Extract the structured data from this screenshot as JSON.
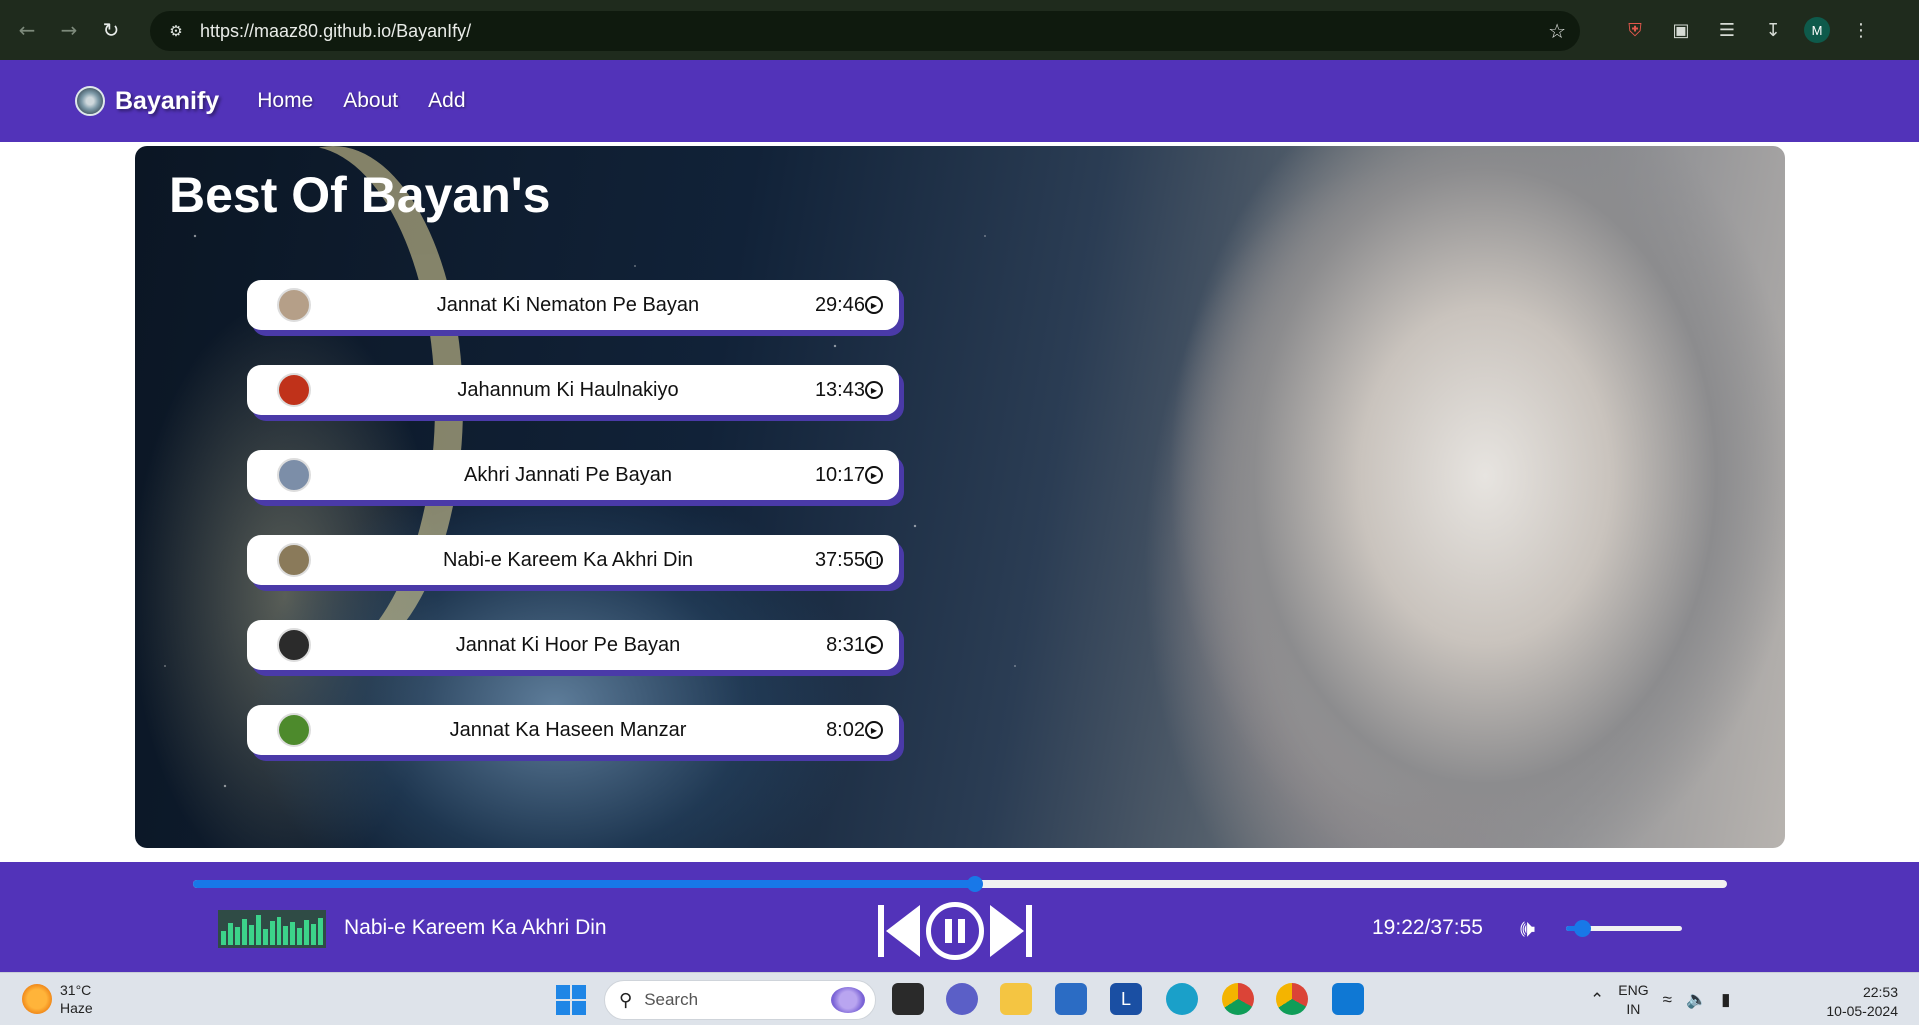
{
  "browser": {
    "url": "https://maaz80.github.io/BayanIfy/",
    "profile_initial": "M",
    "icons": [
      "back-icon",
      "forward-icon",
      "reload-icon",
      "site-info-icon",
      "bookmark-star-icon",
      "shield-extension-icon",
      "extensions-icon",
      "media-queue-icon",
      "download-icon",
      "menu-kebab-icon"
    ]
  },
  "nav": {
    "brand": "Bayanify",
    "links": [
      "Home",
      "About",
      "Add"
    ]
  },
  "banner": {
    "title": "Best Of Bayan's"
  },
  "songs": [
    {
      "title": "Jannat Ki Nematon Pe Bayan",
      "duration": "29:46",
      "state": "play",
      "thumb_color": "#b59f88"
    },
    {
      "title": "Jahannum Ki Haulnakiyo",
      "duration": "13:43",
      "state": "play",
      "thumb_color": "#c0321a"
    },
    {
      "title": "Akhri Jannati Pe Bayan",
      "duration": "10:17",
      "state": "play",
      "thumb_color": "#7c8ea8"
    },
    {
      "title": "Nabi-e Kareem Ka Akhri Din",
      "duration": "37:55",
      "state": "pause",
      "thumb_color": "#8a7a5a"
    },
    {
      "title": "Jannat Ki Hoor Pe Bayan",
      "duration": "8:31",
      "state": "play",
      "thumb_color": "#2b2b2b"
    },
    {
      "title": "Jannat Ka Haseen Manzar",
      "duration": "8:02",
      "state": "play",
      "thumb_color": "#4d8a2c"
    }
  ],
  "player": {
    "now_playing": "Nabi-e Kareem Ka Akhri Din",
    "time": "19:22/37:55",
    "progress_fraction": 0.51,
    "volume_fraction": 0.14,
    "accent": "#1878e8",
    "bar_color": "#5233b9"
  },
  "taskbar": {
    "temperature": "31°C",
    "weather": "Haze",
    "search_placeholder": "Search",
    "lang_top": "ENG",
    "lang_bottom": "IN",
    "time": "22:53",
    "date": "10-05-2024"
  }
}
